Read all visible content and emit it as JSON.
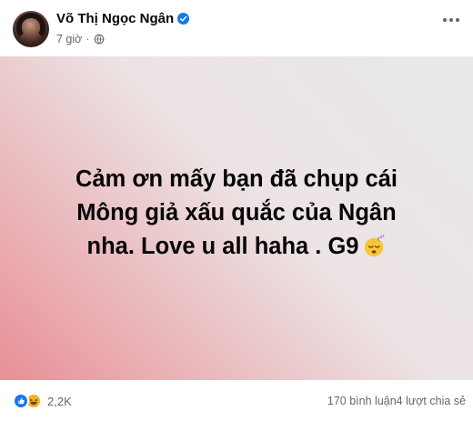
{
  "post": {
    "author_name": "Võ Thị Ngọc Ngân",
    "time": "7 giờ",
    "text_lines": [
      "Cảm ơn mấy bạn đã chụp cái",
      "Mông giả xấu quắc của Ngân",
      "nha. Love u all haha . G9"
    ],
    "background_colors": [
      "#e88f96",
      "#ece3e4",
      "#e9e9eb"
    ]
  },
  "footer": {
    "reaction_count": "2,2K",
    "comments_shares": "170 bình luận4 lượt chia sẻ"
  },
  "icons": {
    "verified": "verified-badge-icon",
    "audience": "globe-icon",
    "more": "more-options-icon",
    "emoji": "sleeping-face-emoji",
    "reactions": [
      "like-icon",
      "haha-icon"
    ]
  },
  "colors": {
    "facebook_blue": "#1877f2",
    "secondary_text": "#65676b",
    "haha_yellow": "#f7b125"
  }
}
